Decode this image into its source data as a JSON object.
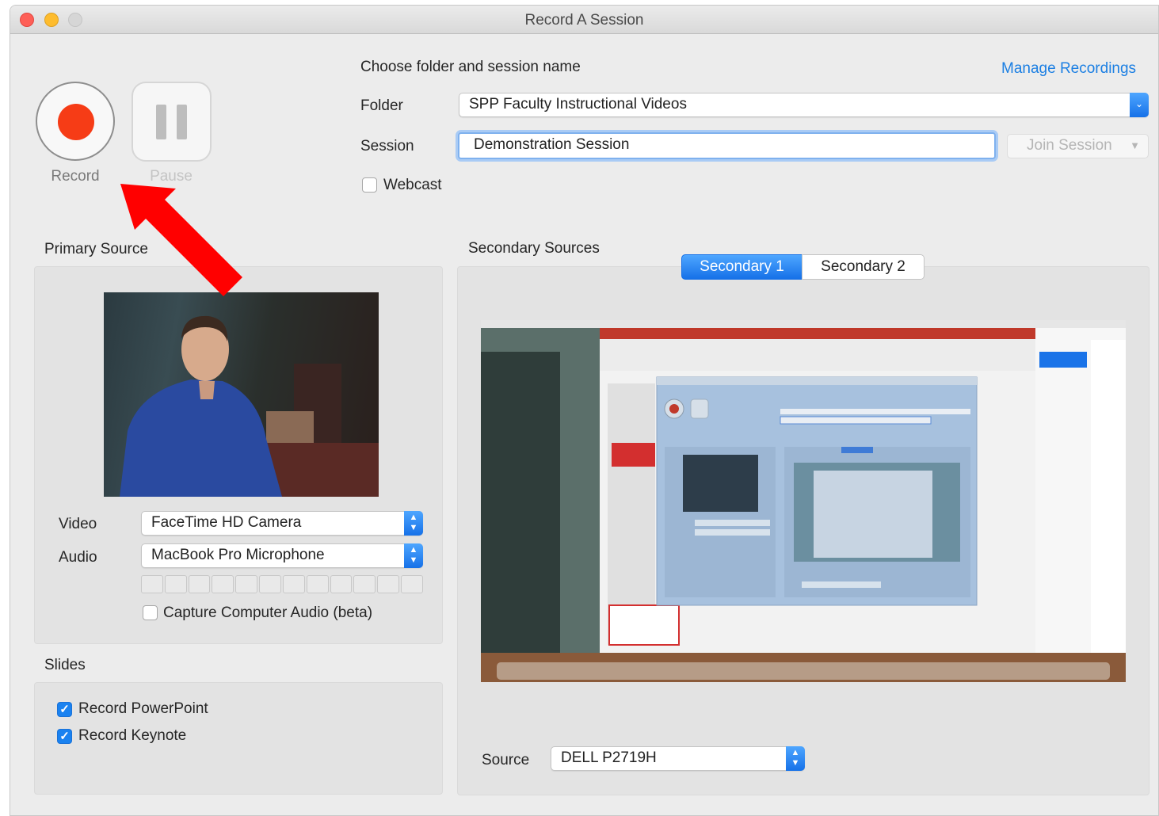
{
  "window": {
    "title": "Record A Session"
  },
  "controls": {
    "record_label": "Record",
    "pause_label": "Pause"
  },
  "session": {
    "heading": "Choose folder and session name",
    "manage_link": "Manage Recordings",
    "folder_label": "Folder",
    "folder_value": "SPP Faculty Instructional Videos",
    "session_label": "Session",
    "session_value": "Demonstration Session",
    "join_label": "Join Session",
    "webcast_label": "Webcast",
    "webcast_checked": false
  },
  "primary": {
    "heading": "Primary Source",
    "video_label": "Video",
    "video_value": "FaceTime HD Camera",
    "audio_label": "Audio",
    "audio_value": "MacBook Pro Microphone",
    "capture_audio_label": "Capture Computer Audio (beta)",
    "capture_audio_checked": false
  },
  "slides": {
    "heading": "Slides",
    "items": [
      {
        "label": "Record PowerPoint",
        "checked": true
      },
      {
        "label": "Record Keynote",
        "checked": true
      }
    ]
  },
  "secondary": {
    "heading": "Secondary Sources",
    "tabs": [
      "Secondary 1",
      "Secondary 2"
    ],
    "active_tab": "Secondary 1",
    "source_label": "Source",
    "source_value": "DELL P2719H"
  },
  "colors": {
    "accent": "#1a82f0",
    "record": "#f63c16",
    "annotation_arrow": "#ff0000"
  }
}
